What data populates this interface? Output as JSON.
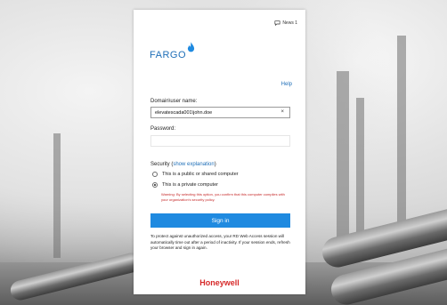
{
  "header": {
    "news_label": "News 1"
  },
  "brand": {
    "logo_text": "FARGO",
    "help_label": "Help"
  },
  "form": {
    "username_label": "Domain\\user name:",
    "username_value": "elevatescada001\\john.doe",
    "clear_glyph": "×",
    "password_label": "Password:",
    "password_value": "",
    "security_prefix": "Security (",
    "security_link": "show explanation",
    "security_suffix": ")",
    "options": [
      {
        "label": "This is a public or shared computer",
        "checked": false
      },
      {
        "label": "This is a private computer",
        "checked": true
      }
    ],
    "warning": "Warning: By selecting this option, you confirm that this computer complies with your organization's security policy.",
    "signin_label": "Sign in"
  },
  "notice": "To protect against unauthorized access, your RD Web Access session will automatically time out after a period of inactivity. If your session ends, refresh your browser and sign in again.",
  "footer": {
    "brand": "Honeywell"
  },
  "colors": {
    "accent": "#1f8ae0",
    "link": "#1f6fb8",
    "warning": "#c62828",
    "brand_red": "#d62828"
  }
}
